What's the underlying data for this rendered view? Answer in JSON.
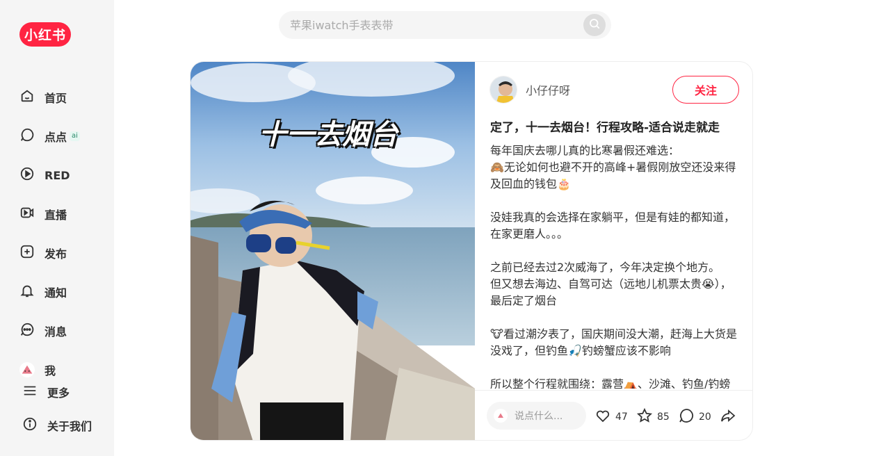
{
  "logo": {
    "text": "小红书"
  },
  "nav": [
    {
      "label": "首页",
      "icon": "home-icon"
    },
    {
      "label": "点点",
      "icon": "chat-bubble-icon",
      "badge": "ai"
    },
    {
      "label": "RED",
      "icon": "play-icon"
    },
    {
      "label": "直播",
      "icon": "live-camera-icon"
    },
    {
      "label": "发布",
      "icon": "plus-square-icon"
    },
    {
      "label": "通知",
      "icon": "bell-icon"
    },
    {
      "label": "消息",
      "icon": "message-dots-icon"
    },
    {
      "label": "我",
      "icon": "avatar"
    },
    {
      "label": "更多",
      "icon": "menu-icon"
    },
    {
      "label": "关于我们",
      "icon": "info-icon"
    }
  ],
  "search": {
    "placeholder": "苹果iwatch手表表带"
  },
  "photo": {
    "overlay_text": "十一去烟台"
  },
  "post": {
    "author": "小仔仔呀",
    "follow_label": "关注",
    "title": "定了，十一去烟台！行程攻略-适合说走就走",
    "paragraphs": [
      "每年国庆去哪儿真的比寒暑假还难选：\n🙈无论如何也避不开的高峰+暑假刚放空还没来得及回血的钱包🎂",
      "没娃我真的会选择在家躺平，但是有娃的都知道，在家更磨人。。。",
      "之前已经去过2次威海了，今年决定换个地方。\n但又想去海边、自驾可达（远地儿机票太贵😭），最后定了烟台",
      "🐮看过潮汐表了，国庆期间没大潮，赶海上大货是没戏了，但钓鱼🎣钓螃蟹应该不影响",
      "所以整个行程就围绕：露营⛺、沙滩、钓鱼/钓螃"
    ]
  },
  "footer": {
    "comment_placeholder": "说点什么...",
    "likes": "47",
    "collects": "85",
    "comments": "20"
  },
  "colors": {
    "brand": "#ff2442",
    "sidebar_bg": "#f5f5f5"
  }
}
